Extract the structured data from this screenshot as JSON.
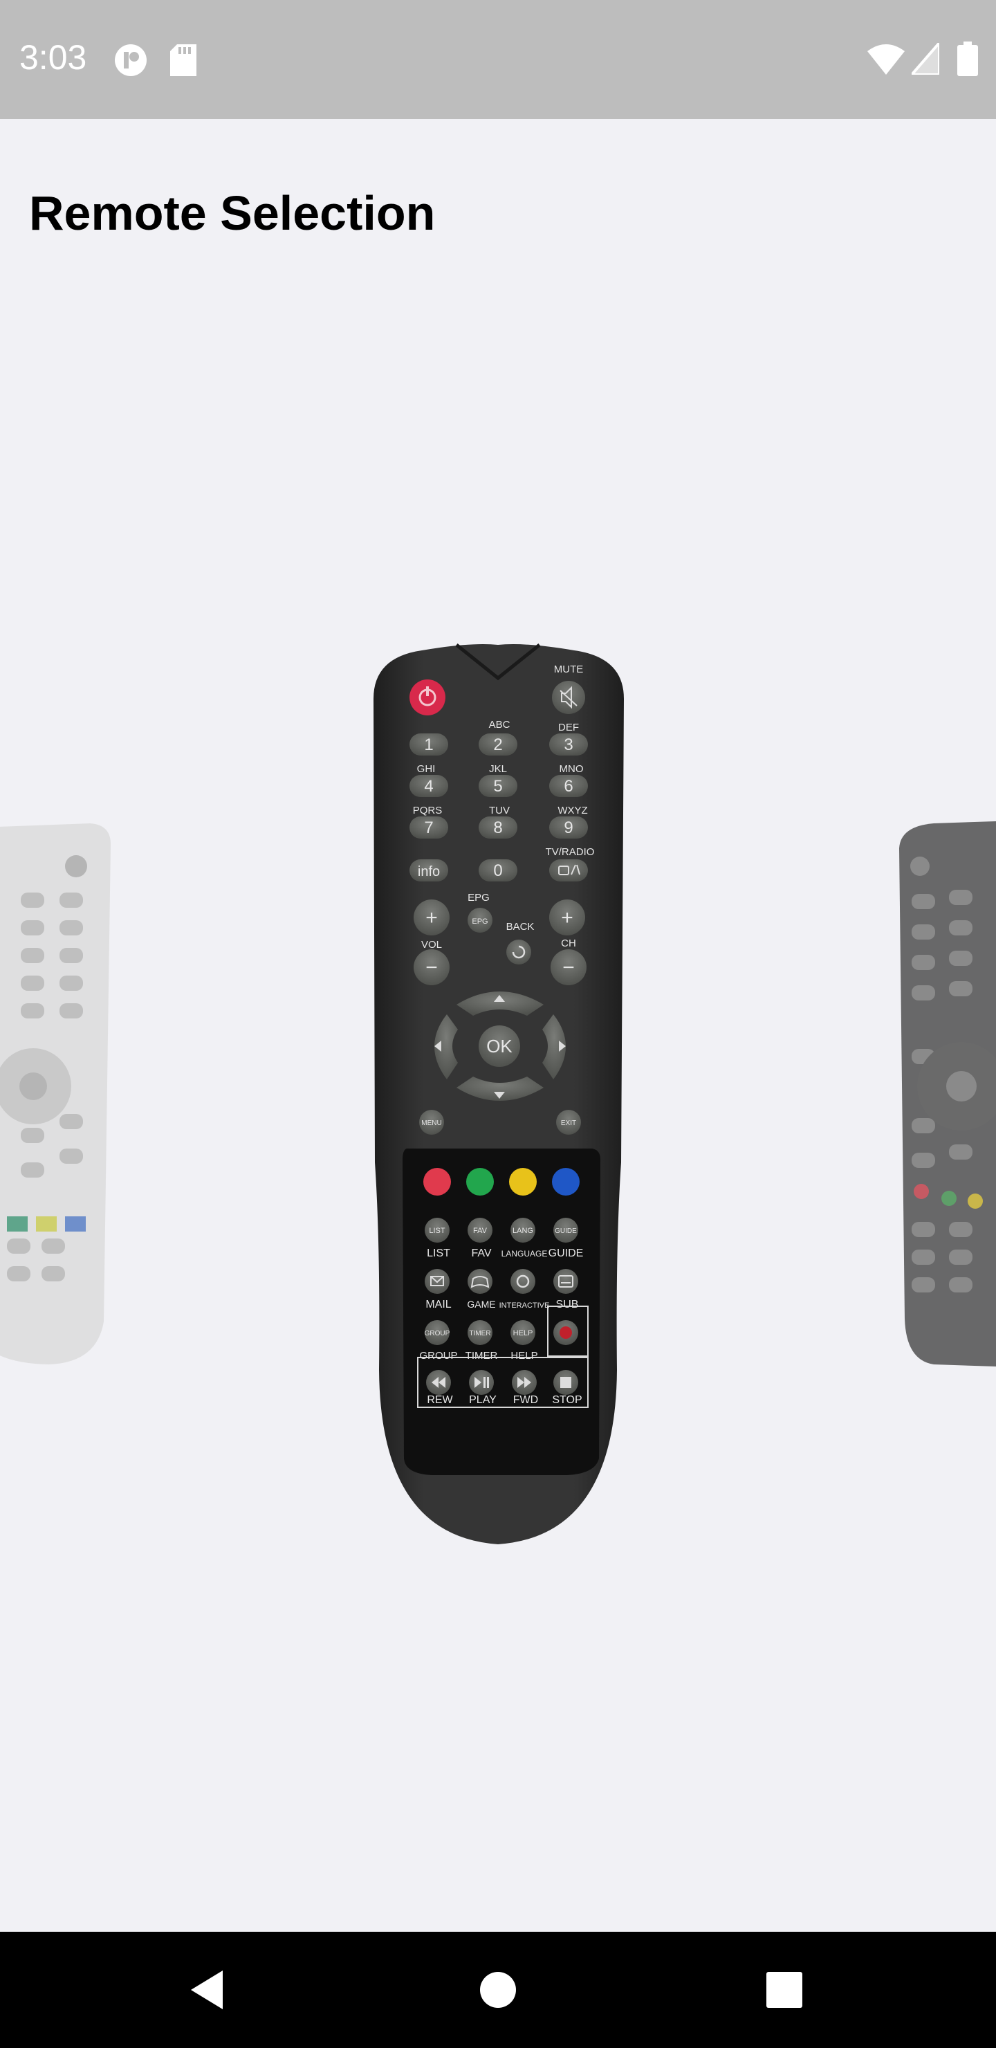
{
  "status_bar": {
    "time": "3:03",
    "icons": [
      "notification-app-icon",
      "sd-card-icon",
      "wifi-icon",
      "cell-signal-icon",
      "battery-icon"
    ]
  },
  "page": {
    "title": "Remote Selection"
  },
  "remote": {
    "mute": "MUTE",
    "abc": "ABC",
    "def": "DEF",
    "ghi": "GHI",
    "jkl": "JKL",
    "mno": "MNO",
    "pqrs": "PQRS",
    "tuv": "TUV",
    "wxyz": "WXYZ",
    "tvradio": "TV/RADIO",
    "digits": [
      "1",
      "2",
      "3",
      "4",
      "5",
      "6",
      "7",
      "8",
      "9",
      "0"
    ],
    "info": "info",
    "epg_label": "EPG",
    "epg_btn": "EPG",
    "back": "BACK",
    "vol": "VOL",
    "ch": "CH",
    "plus": "+",
    "minus": "−",
    "ok": "OK",
    "menu": "MENU",
    "exit": "EXIT",
    "row1": [
      "LIST",
      "FAV",
      "LANGUAGE",
      "GUIDE"
    ],
    "row1_btn": [
      "LIST",
      "FAV",
      "LANG",
      "GUIDE"
    ],
    "row2": [
      "MAIL",
      "GAME",
      "INTERACTIVE",
      "SUB"
    ],
    "row3": [
      "GROUP",
      "TIMER",
      "HELP"
    ],
    "row3_btn": [
      "GROUP",
      "TIMER",
      "HELP"
    ],
    "row4": [
      "REW",
      "PLAY",
      "FWD",
      "STOP"
    ],
    "color_buttons": [
      "#e03a4d",
      "#22a64d",
      "#e8c21a",
      "#1f57c6"
    ]
  },
  "colors": {
    "status_bar": "#bdbdbd",
    "background": "#f1f1f5",
    "nav_bar": "#000000",
    "remote_body": "#2d2d2d",
    "button_gray": "#5f615d"
  }
}
